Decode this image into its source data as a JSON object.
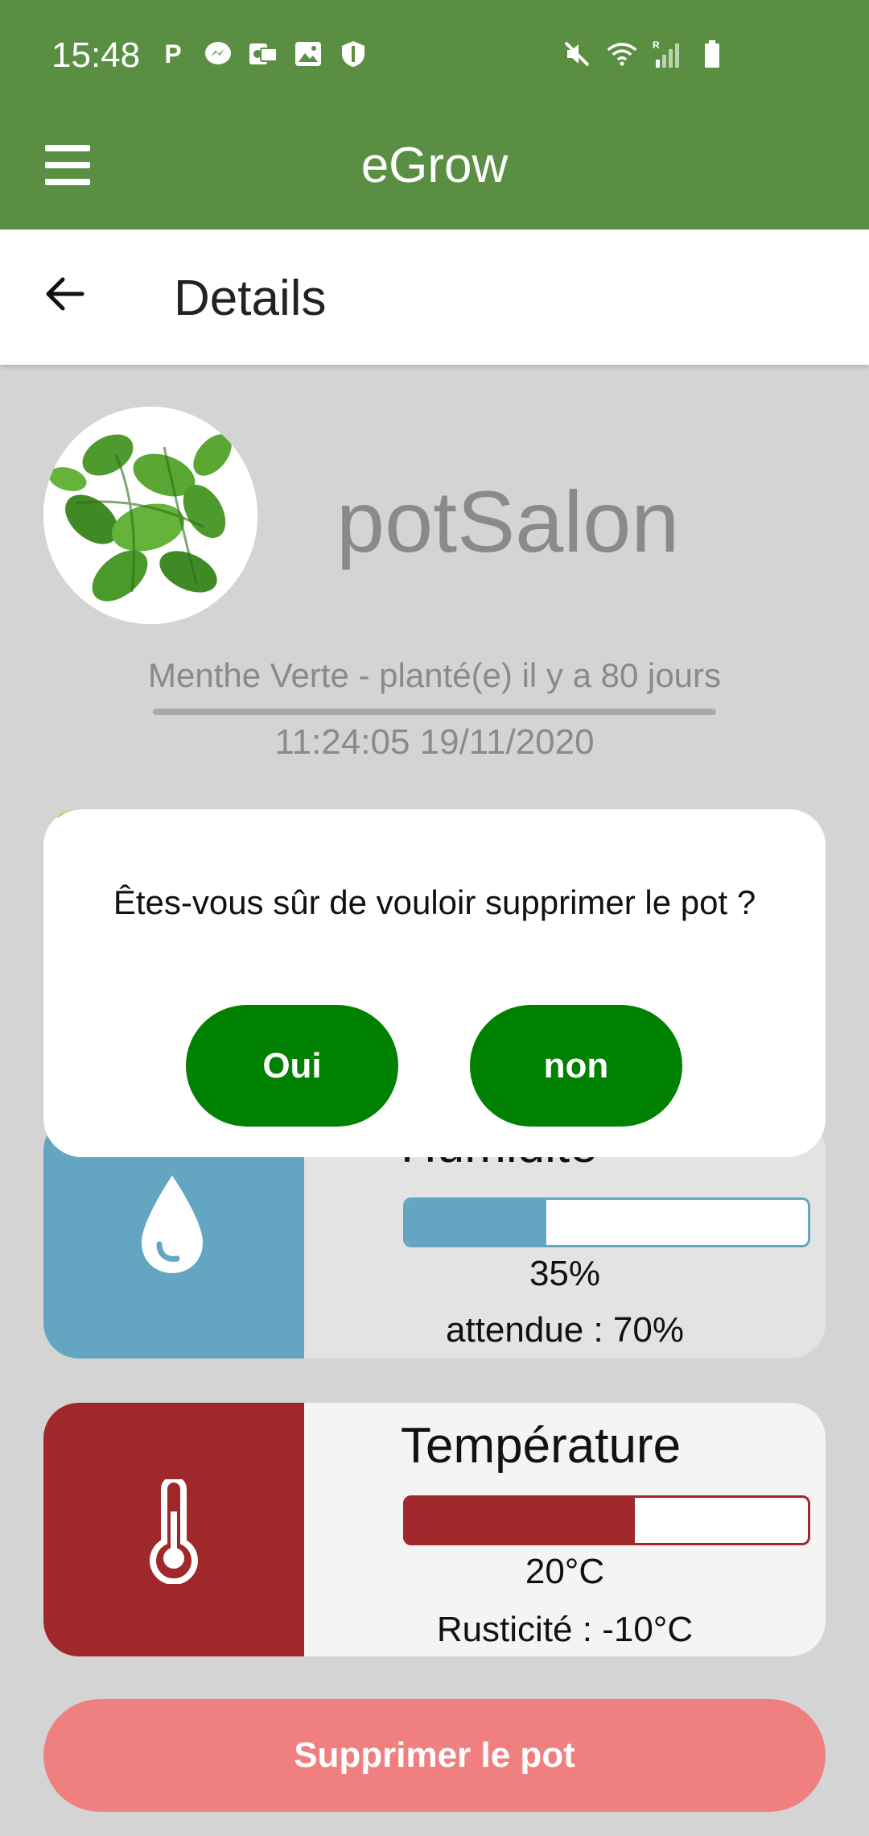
{
  "status_bar": {
    "time": "15:48",
    "left_icons": [
      "parking-icon",
      "messenger-icon",
      "outlook-icon",
      "gallery-icon",
      "shield-icon"
    ],
    "right_icons": [
      "mute-icon",
      "wifi-icon",
      "signal-icon",
      "battery-icon"
    ]
  },
  "app_bar": {
    "title": "eGrow",
    "menu_icon": "menu-icon"
  },
  "sub_header": {
    "title": "Details",
    "back_icon": "back-arrow-icon"
  },
  "pot": {
    "name": "potSalon",
    "info": "Menthe Verte - planté(e) il y a 80 jours",
    "timestamp": "11:24:05 19/11/2020"
  },
  "light_card": {
    "accent_color": "#d9b13b"
  },
  "humidity_card": {
    "title": "Humidité",
    "value": "35%",
    "fill_fraction": 0.35,
    "note": "attendue : 70%",
    "icon": "water-drop-icon",
    "color": "#64a6c1"
  },
  "temperature_card": {
    "title": "Température",
    "value": "20°C",
    "fill_fraction": 0.57,
    "note": "Rusticité : -10°C",
    "icon": "thermometer-icon",
    "color": "#a0272a"
  },
  "delete_button": {
    "label": "Supprimer le pot",
    "color": "#f08080"
  },
  "dialog": {
    "message": "Êtes-vous sûr de vouloir supprimer le pot ?",
    "yes_label": "Oui",
    "no_label": "non",
    "button_color": "#018101"
  },
  "colors": {
    "primary": "#5a8f43"
  }
}
